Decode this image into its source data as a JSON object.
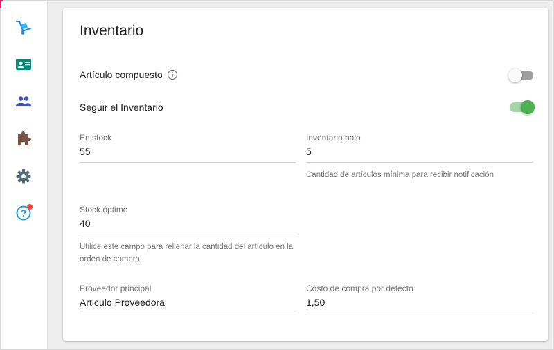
{
  "sidebar": {
    "items": [
      {
        "name": "inventory",
        "icon": "hand-truck-icon"
      },
      {
        "name": "contacts",
        "icon": "contact-card-icon"
      },
      {
        "name": "users",
        "icon": "people-icon"
      },
      {
        "name": "extensions",
        "icon": "puzzle-icon"
      },
      {
        "name": "settings",
        "icon": "gear-icon"
      },
      {
        "name": "help",
        "icon": "help-circle-icon",
        "has_notification": true
      }
    ],
    "colors": {
      "blue": "#1e88e5",
      "teal": "#00897b",
      "indigo": "#3f51b5",
      "brown": "#795548",
      "slate": "#546e7a",
      "help": "#1e9be3",
      "badge": "#f44336"
    }
  },
  "card": {
    "title": "Inventario",
    "composite": {
      "label": "Artículo compuesto",
      "enabled": false
    },
    "track_inventory": {
      "label": "Seguir el Inventario",
      "enabled": true
    },
    "fields": {
      "in_stock": {
        "label": "En stock",
        "value": "55"
      },
      "low_stock": {
        "label": "Inventario bajo",
        "value": "5",
        "hint": "Cantidad de artículos mínima para recibir notificación"
      },
      "optimal_stock": {
        "label": "Stock óptimo",
        "value": "40",
        "hint": "Utilice este campo para rellenar la cantidad del artículo en la orden de compra"
      },
      "primary_supplier": {
        "label": "Proveedor principal",
        "value": "Articulo Proveedora"
      },
      "default_cost": {
        "label": "Costo de compra por defecto",
        "value": "1,50"
      }
    }
  },
  "colors": {
    "toggle_on": "#4caf50",
    "toggle_on_track": "#a5d6a7",
    "toggle_off_track": "#9e9e9e"
  }
}
